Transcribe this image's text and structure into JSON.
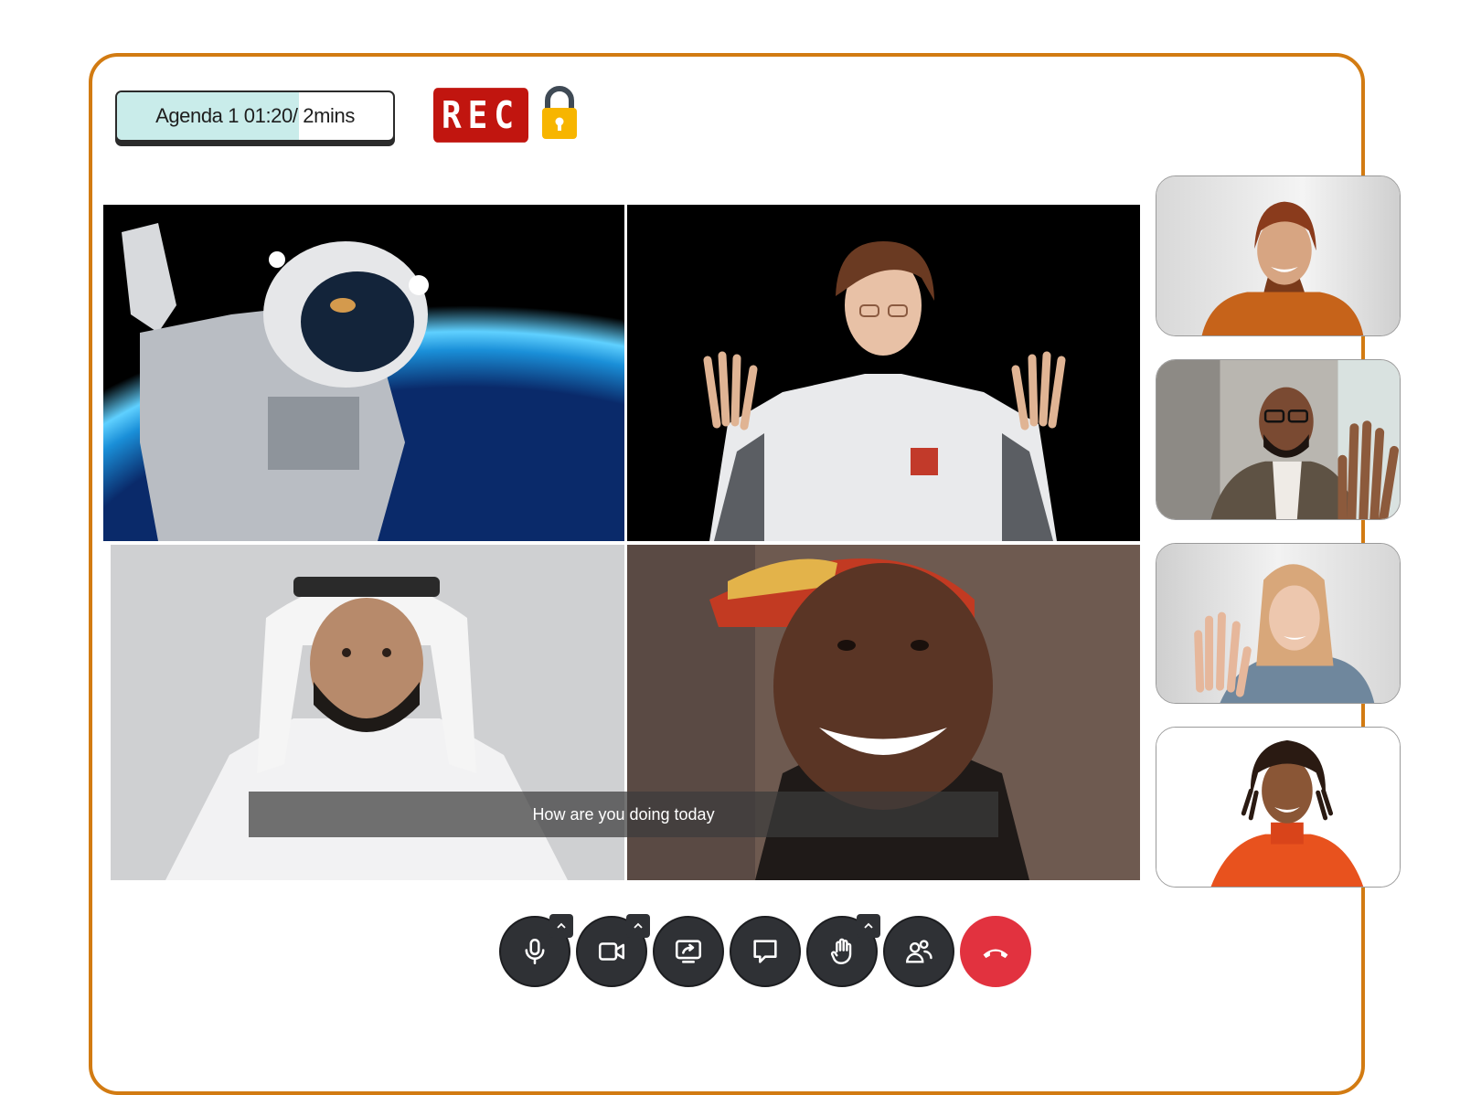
{
  "agenda": {
    "label": "Agenda 1 01:20/ 2mins",
    "progress": 0.66
  },
  "recording": {
    "label": "REC"
  },
  "caption": {
    "text": "How are you doing today"
  },
  "controls": [
    {
      "name": "microphone-button",
      "icon": "microphone-icon",
      "has_caret": true
    },
    {
      "name": "camera-button",
      "icon": "video-camera-icon",
      "has_caret": true
    },
    {
      "name": "share-screen-button",
      "icon": "share-screen-icon",
      "has_caret": false
    },
    {
      "name": "chat-button",
      "icon": "chat-bubble-icon",
      "has_caret": false
    },
    {
      "name": "raise-hand-button",
      "icon": "raise-hand-icon",
      "has_caret": true
    },
    {
      "name": "participants-button",
      "icon": "participants-icon",
      "has_caret": false
    },
    {
      "name": "end-call-button",
      "icon": "hang-up-phone-icon",
      "has_caret": false
    }
  ],
  "colors": {
    "frame": "#d27b12",
    "rec": "#c1150f",
    "end_call": "#e2323f",
    "control_bg": "#2f3135",
    "lock": "#f7b500"
  }
}
